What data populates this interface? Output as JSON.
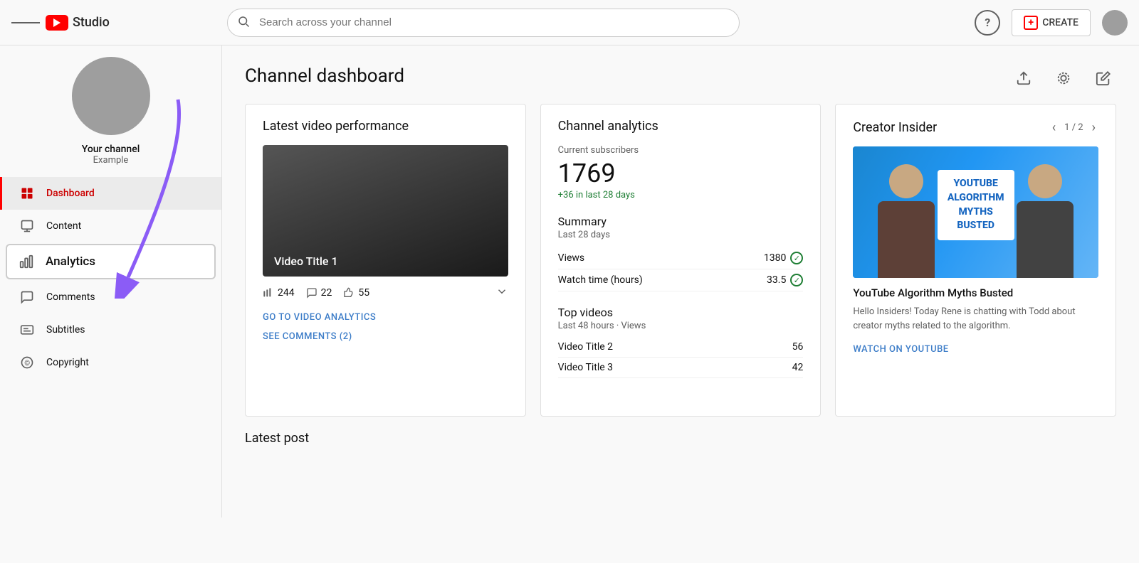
{
  "nav": {
    "hamburger_label": "Menu",
    "logo_text": "Studio",
    "search_placeholder": "Search across your channel",
    "help_label": "?",
    "create_label": "CREATE",
    "avatar_label": "User avatar"
  },
  "sidebar": {
    "avatar_label": "Channel avatar",
    "channel_name": "Your channel",
    "channel_sub": "Example",
    "items": [
      {
        "id": "dashboard",
        "label": "Dashboard",
        "active": true
      },
      {
        "id": "content",
        "label": "Content",
        "active": false
      },
      {
        "id": "analytics",
        "label": "Analytics",
        "active": false
      },
      {
        "id": "comments",
        "label": "Comments",
        "active": false
      },
      {
        "id": "subtitles",
        "label": "Subtitles",
        "active": false
      },
      {
        "id": "copyright",
        "label": "Copyright",
        "active": false
      }
    ]
  },
  "main": {
    "page_title": "Channel dashboard",
    "icons": {
      "upload": "upload-icon",
      "live": "live-icon",
      "edit": "edit-icon"
    },
    "latest_video": {
      "title": "Latest video performance",
      "video_thumb_title": "Video Title 1",
      "stats": {
        "views": "244",
        "comments": "22",
        "likes": "55"
      },
      "go_analytics_link": "GO TO VIDEO ANALYTICS",
      "see_comments_link": "SEE COMMENTS (2)"
    },
    "channel_analytics": {
      "title": "Channel analytics",
      "current_subscribers_label": "Current subscribers",
      "subscribers": "1769",
      "growth": "+36 in last 28 days",
      "summary_title": "Summary",
      "summary_sub": "Last 28 days",
      "rows": [
        {
          "label": "Views",
          "value": "1380",
          "check": true
        },
        {
          "label": "Watch time (hours)",
          "value": "33.5",
          "check": true
        }
      ],
      "top_videos_title": "Top videos",
      "top_videos_sub": "Last 48 hours · Views",
      "videos": [
        {
          "title": "Video Title 2",
          "views": "56"
        },
        {
          "title": "Video Title 3",
          "views": "42"
        }
      ]
    },
    "creator_insider": {
      "title": "Creator Insider",
      "pagination": "1 / 2",
      "video_title": "YouTube Algorithm Myths Busted",
      "description": "Hello Insiders! Today Rene is chatting with Todd about creator myths related to the algorithm.",
      "watch_link": "WATCH ON YOUTUBE",
      "thumb_badge_line1": "YOUTUBE",
      "thumb_badge_line2": "ALGORITHM",
      "thumb_badge_line3": "MYTHS",
      "thumb_badge_line4": "BUSTED"
    }
  }
}
